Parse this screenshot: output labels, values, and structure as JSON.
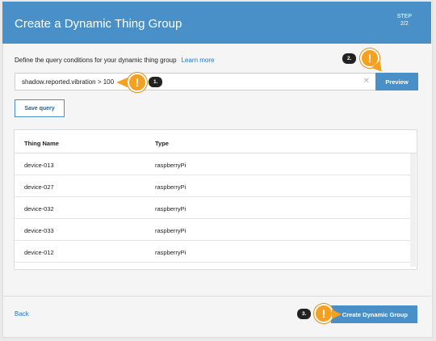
{
  "header": {
    "title": "Create a Dynamic Thing Group",
    "step_line1": "STEP",
    "step_line2": "2/2"
  },
  "query": {
    "description": "Define the query conditions for your dynamic thing group",
    "learn_more": "Learn more",
    "value": "shadow.reported.vibration > 100",
    "clear_icon": "close-icon",
    "preview_label": "Preview",
    "save_label": "Save query"
  },
  "table": {
    "columns": [
      "Thing Name",
      "Type"
    ],
    "rows": [
      [
        "device-013",
        "raspberryPi"
      ],
      [
        "device-027",
        "raspberryPi"
      ],
      [
        "device-032",
        "raspberryPi"
      ],
      [
        "device-033",
        "raspberryPi"
      ],
      [
        "device-012",
        "raspberryPi"
      ]
    ]
  },
  "footer": {
    "back_label": "Back",
    "create_label": "Create Dynamic Group"
  },
  "callouts": [
    {
      "label": "1.",
      "icon": "warning-icon"
    },
    {
      "label": "2.",
      "icon": "warning-icon"
    },
    {
      "label": "3.",
      "icon": "warning-icon"
    }
  ],
  "colors": {
    "header_bg": "#4a90c8",
    "accent": "#4a90c8",
    "link": "#1f78c8",
    "callout": "#f5a020"
  }
}
